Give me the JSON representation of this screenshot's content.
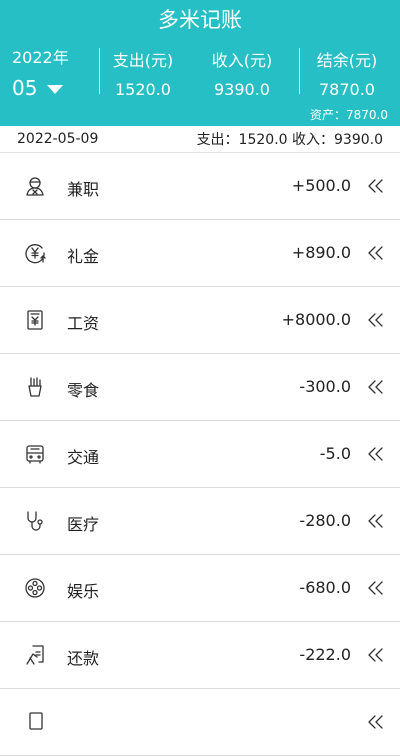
{
  "app": {
    "title": "多米记账"
  },
  "header": {
    "year": "2022年",
    "month": "05",
    "expense_label": "支出(元)",
    "expense_value": "1520.0",
    "income_label": "收入(元)",
    "income_value": "9390.0",
    "balance_label": "结余(元)",
    "balance_value": "7870.0",
    "assets_text": "资产：7870.0"
  },
  "summary": {
    "date": "2022-05-09",
    "totals": "支出：1520.0 收入：9390.0"
  },
  "records": [
    {
      "icon": "part-time-icon",
      "name": "兼职",
      "amount": "+500.0"
    },
    {
      "icon": "gift-money-icon",
      "name": "礼金",
      "amount": "+890.0"
    },
    {
      "icon": "salary-icon",
      "name": "工资",
      "amount": "+8000.0"
    },
    {
      "icon": "snack-icon",
      "name": "零食",
      "amount": "-300.0"
    },
    {
      "icon": "transport-icon",
      "name": "交通",
      "amount": "-5.0"
    },
    {
      "icon": "medical-icon",
      "name": "医疗",
      "amount": "-280.0"
    },
    {
      "icon": "entertainment-icon",
      "name": "娱乐",
      "amount": "-680.0"
    },
    {
      "icon": "repayment-icon",
      "name": "还款",
      "amount": "-222.0"
    }
  ],
  "colors": {
    "header_bg": "#26bfc5",
    "text": "#222222",
    "divider": "#dcdcdc"
  }
}
